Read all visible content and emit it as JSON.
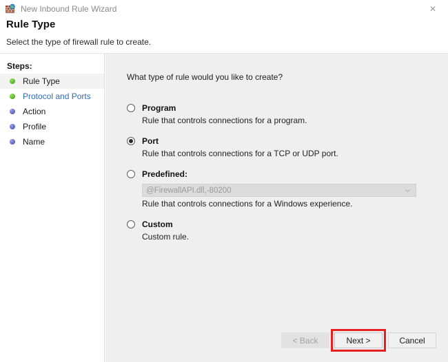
{
  "window": {
    "title": "New Inbound Rule Wizard",
    "icon": "firewall-globe-icon",
    "close_label": "✕"
  },
  "header": {
    "title": "Rule Type",
    "subtitle": "Select the type of firewall rule to create."
  },
  "sidebar": {
    "steps_label": "Steps:",
    "items": [
      {
        "label": "Rule Type",
        "bullet": "green",
        "state": "current"
      },
      {
        "label": "Protocol and Ports",
        "bullet": "green",
        "state": "link"
      },
      {
        "label": "Action",
        "bullet": "blue",
        "state": "pending"
      },
      {
        "label": "Profile",
        "bullet": "blue",
        "state": "pending"
      },
      {
        "label": "Name",
        "bullet": "blue",
        "state": "pending"
      }
    ]
  },
  "main": {
    "question": "What type of rule would you like to create?",
    "options": [
      {
        "title": "Program",
        "description": "Rule that controls connections for a program.",
        "selected": false
      },
      {
        "title": "Port",
        "description": "Rule that controls connections for a TCP or UDP port.",
        "selected": true
      },
      {
        "title": "Predefined:",
        "description": "Rule that controls connections for a Windows experience.",
        "selected": false,
        "combo_value": "@FirewallAPI.dll,-80200",
        "combo_arrow": "⌄"
      },
      {
        "title": "Custom",
        "description": "Custom rule.",
        "selected": false
      }
    ]
  },
  "footer": {
    "back_label": "< Back",
    "next_label": "Next >",
    "cancel_label": "Cancel"
  },
  "colors": {
    "link": "#2f6cb5",
    "highlight": "#e62020",
    "content_bg": "#efefef",
    "bullet_green": "#62c332",
    "bullet_blue": "#6b74c9"
  }
}
